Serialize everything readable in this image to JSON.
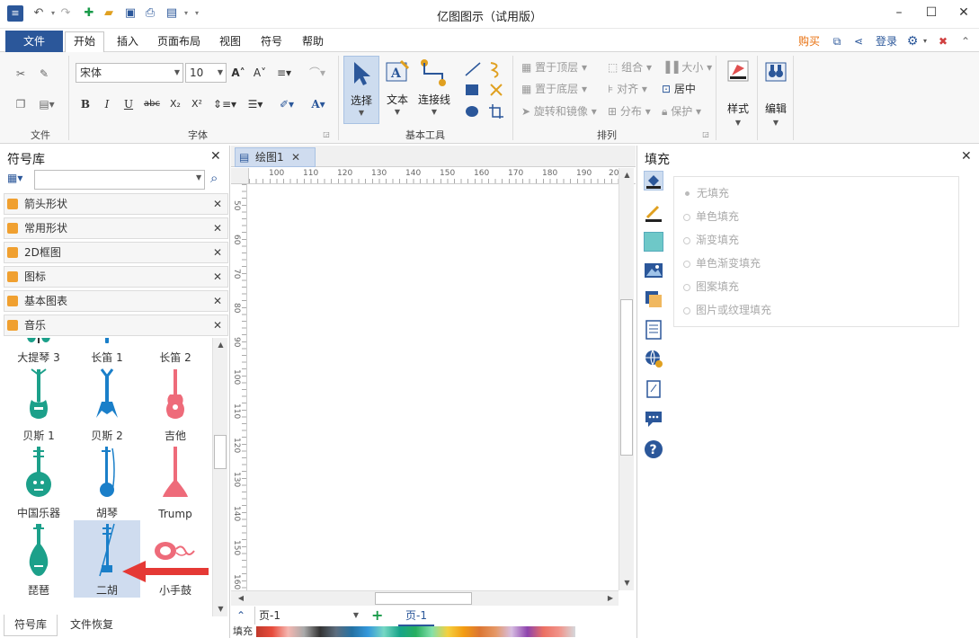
{
  "window": {
    "title": "亿图图示（试用版）"
  },
  "menu": {
    "file": "文件",
    "tabs": [
      "开始",
      "插入",
      "页面布局",
      "视图",
      "符号",
      "帮助"
    ],
    "buy": "购买",
    "login": "登录"
  },
  "ribbon": {
    "groups": {
      "file": "文件",
      "font": "字体",
      "basic_tools": "基本工具",
      "arrange": "排列"
    },
    "font_name": "宋体",
    "font_size": "10",
    "select": "选择",
    "text": "文本",
    "connector": "连接线",
    "bring_front": "置于顶层",
    "send_back": "置于底层",
    "rotate_mirror": "旋转和镜像",
    "group": "组合",
    "align": "对齐",
    "distribute": "分布",
    "size": "大小",
    "center": "居中",
    "protect": "保护",
    "style": "样式",
    "edit": "编辑"
  },
  "symbol_library": {
    "title": "符号库",
    "search_placeholder": "",
    "categories": [
      "箭头形状",
      "常用形状",
      "2D框图",
      "图标",
      "基本图表",
      "音乐"
    ],
    "symbols": [
      {
        "label": "大提琴 3"
      },
      {
        "label": "长笛 1"
      },
      {
        "label": "长笛 2"
      },
      {
        "label": "贝斯 1"
      },
      {
        "label": "贝斯 2"
      },
      {
        "label": "吉他"
      },
      {
        "label": "中国乐器"
      },
      {
        "label": "胡琴"
      },
      {
        "label": "Trump"
      },
      {
        "label": "琵琶"
      },
      {
        "label": "二胡"
      },
      {
        "label": "小手鼓"
      }
    ],
    "bottom_tabs": [
      "符号库",
      "文件恢复"
    ]
  },
  "canvas": {
    "doc_tab": "绘图1",
    "ruler_h": [
      "100",
      "110",
      "120",
      "130",
      "140",
      "150",
      "160",
      "170",
      "180",
      "190",
      "20"
    ],
    "ruler_v": [
      "50",
      "60",
      "70",
      "80",
      "90",
      "100",
      "110",
      "120",
      "130",
      "140",
      "150",
      "160"
    ],
    "page_selector": "页-1",
    "page_tab": "页-1",
    "fill_label": "填充"
  },
  "fill_panel": {
    "title": "填充",
    "options": [
      "无填充",
      "单色填充",
      "渐变填充",
      "单色渐变填充",
      "图案填充",
      "图片或纹理填充"
    ]
  },
  "colors": {
    "brand": "#2b579a",
    "accent_blue": "#1a8ad4",
    "symbol_teal": "#1ca08a",
    "symbol_blue": "#1a7fc9",
    "symbol_pink": "#ee6b7a",
    "buy": "#e8700f",
    "arrow": "#e53935"
  }
}
